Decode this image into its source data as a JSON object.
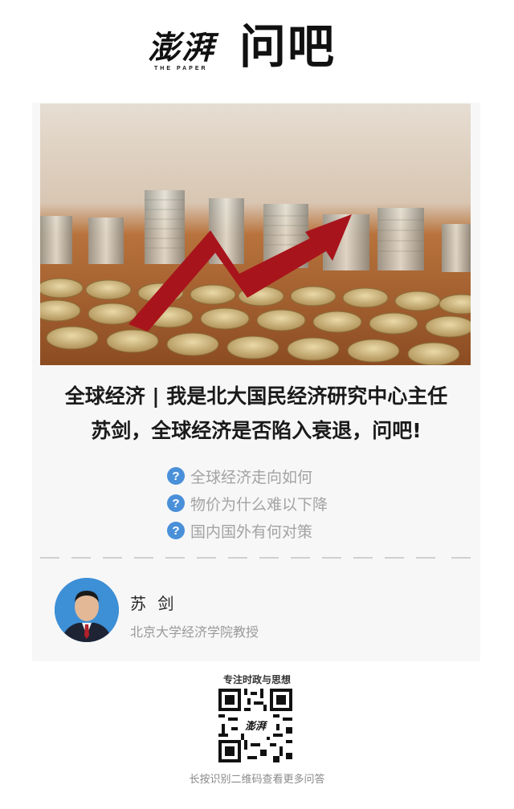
{
  "header": {
    "logo_cn": "澎湃",
    "logo_en": "THE PAPER",
    "product": "问吧"
  },
  "topic": {
    "title_line1": "全球经济 | 我是北大国民经济研究中心主任",
    "title_line2": "苏剑，全球经济是否陷入衰退，问吧!",
    "questions": [
      "全球经济走向如何",
      "物价为什么难以下降",
      "国内国外有何对策"
    ],
    "question_icon": "?"
  },
  "expert": {
    "name": "苏 剑",
    "title": "北京大学经济学院教授"
  },
  "footer": {
    "qr_caption": "专注时政与思想",
    "qr_center_text": "澎湃",
    "hint": "长按识别二维码查看更多问答"
  },
  "colors": {
    "accent": "#4a90d9",
    "card_bg": "#f7f7f7",
    "muted_text": "#a3a3a3"
  }
}
